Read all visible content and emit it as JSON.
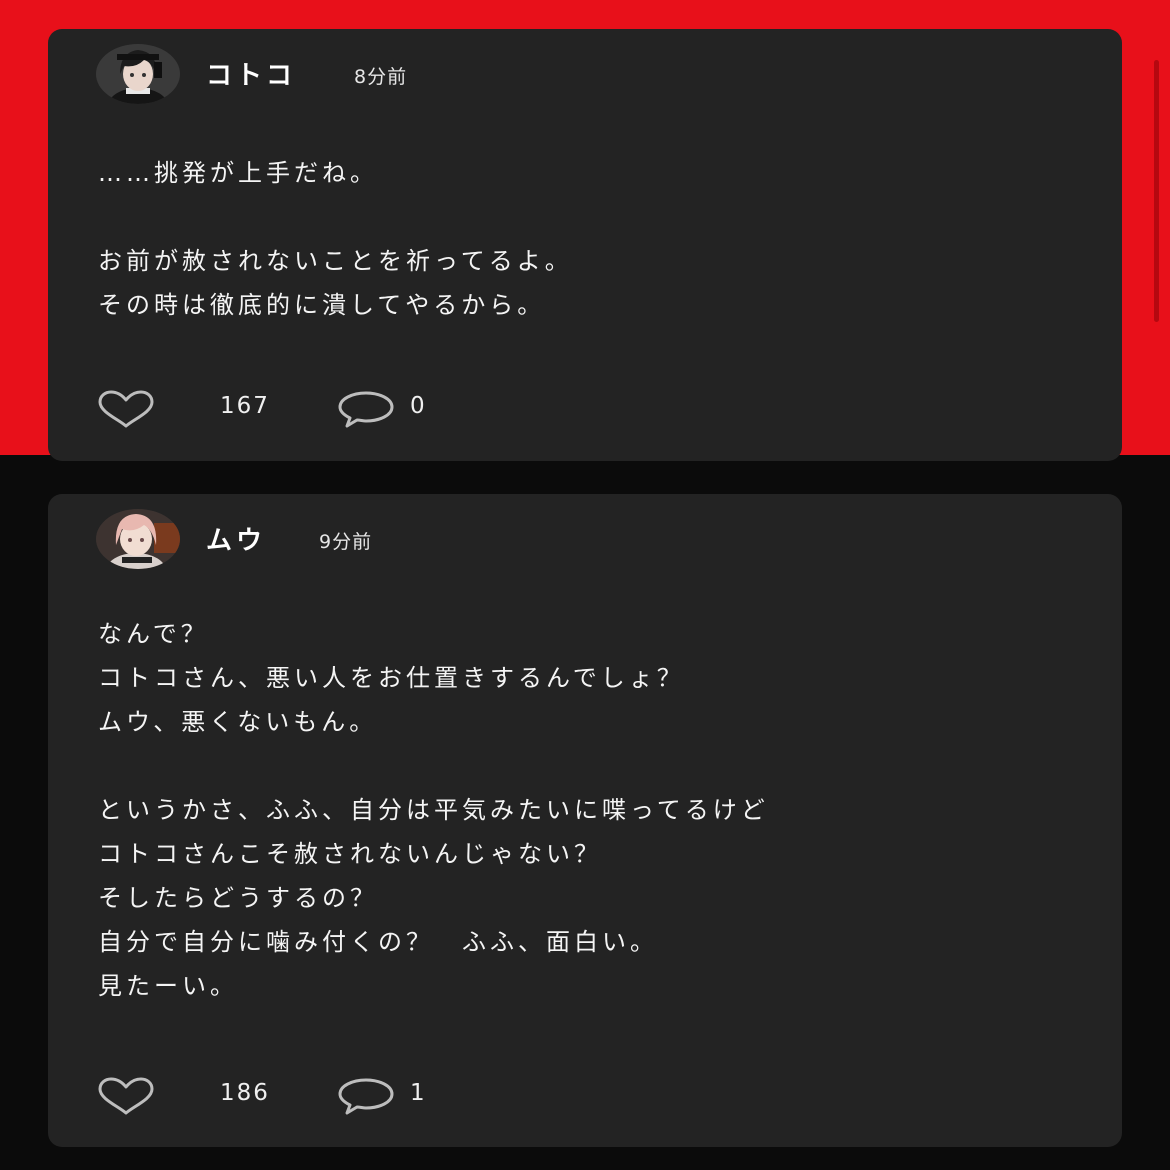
{
  "colors": {
    "top_background": "#e8101a",
    "bottom_background": "#0b0b0b",
    "card": "#232323",
    "text": "#f2f2f2",
    "icon_stroke": "#bdbdbd"
  },
  "posts": [
    {
      "username": "コトコ",
      "timestamp": "8分前",
      "avatar_icon": "avatar-dark-hair-icon",
      "lines": [
        "……挑発が上手だね。",
        "",
        "お前が赦されないことを祈ってるよ。",
        "その時は徹底的に潰してやるから。"
      ],
      "likes": "167",
      "comments": "0"
    },
    {
      "username": "ムウ",
      "timestamp": "9分前",
      "avatar_icon": "avatar-pink-hair-icon",
      "lines": [
        "なんで？",
        "コトコさん、悪い人をお仕置きするんでしょ？",
        "ムウ、悪くないもん。",
        "",
        "というかさ、ふふ、自分は平気みたいに喋ってるけど",
        "コトコさんこそ赦されないんじゃない？",
        "そしたらどうするの？",
        "自分で自分に噛み付くの？　ふふ、面白い。",
        "見たーい。"
      ],
      "likes": "186",
      "comments": "1"
    }
  ]
}
